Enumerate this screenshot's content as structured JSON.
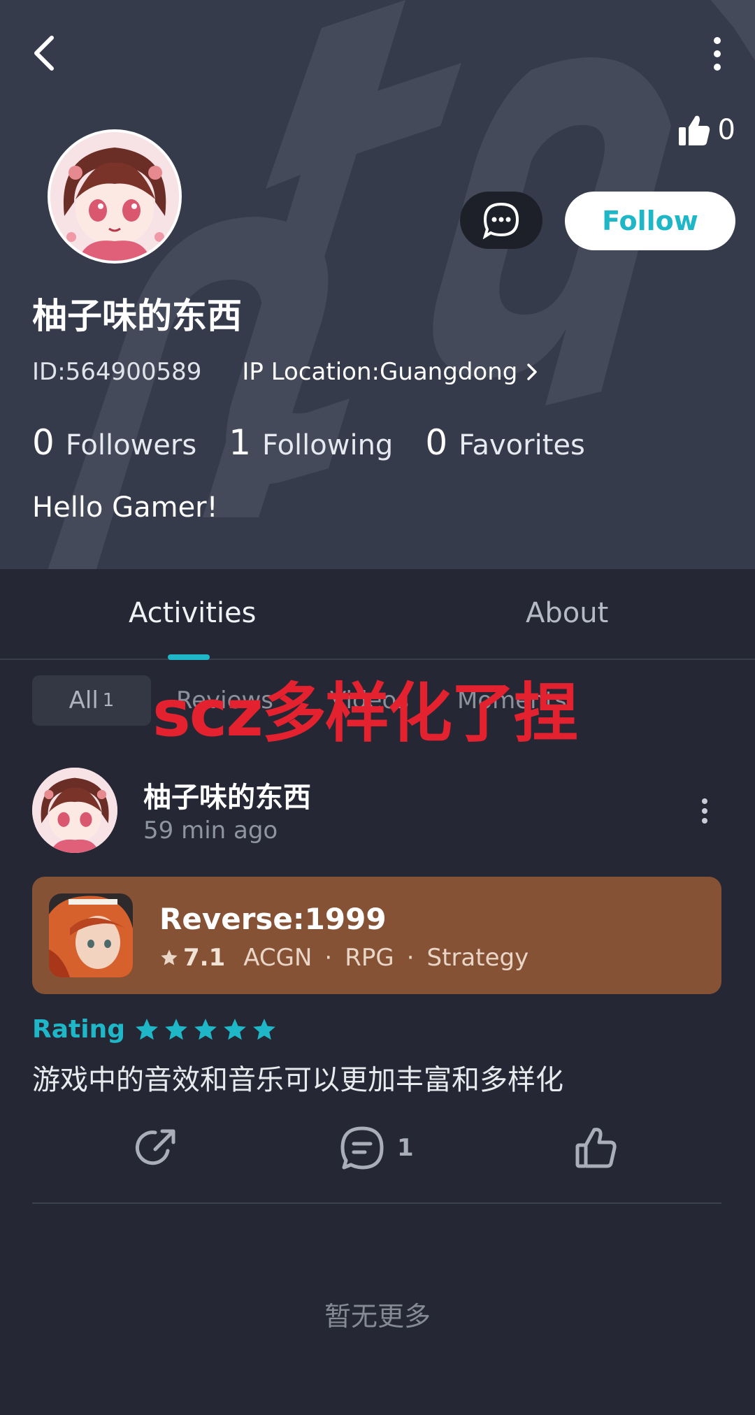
{
  "header": {
    "like_count": "0",
    "follow_label": "Follow",
    "username": "柚子味的东西",
    "user_id": "ID:564900589",
    "ip_location": "IP Location:Guangdong",
    "stats": [
      {
        "count": "0",
        "label": "Followers"
      },
      {
        "count": "1",
        "label": "Following"
      },
      {
        "count": "0",
        "label": "Favorites"
      }
    ],
    "bio": "Hello Gamer!"
  },
  "tabs": [
    {
      "label": "Activities",
      "active": true
    },
    {
      "label": "About",
      "active": false
    }
  ],
  "filters": {
    "all_label": "All",
    "all_count": "1",
    "chips": [
      "Reviews",
      "Videos",
      "Moments"
    ]
  },
  "overlay_text": "scz多样化了捏",
  "post": {
    "author": "柚子味的东西",
    "time": "59 min ago",
    "game": {
      "title": "Reverse:1999",
      "score": "7.1",
      "tags": [
        "ACGN",
        "RPG",
        "Strategy"
      ]
    },
    "rating_label": "Rating",
    "rating_stars": 5,
    "review": "游戏中的音效和音乐可以更加丰富和多样化",
    "comment_count": "1"
  },
  "footer": {
    "no_more": "暂无更多"
  },
  "colors": {
    "accent": "#1fb7c7",
    "header_bg": "#363b4b",
    "page_bg": "#252834",
    "game_card": "#865236",
    "overlay": "#e3212f"
  },
  "icons": [
    "back-arrow-icon",
    "more-vertical-icon",
    "thumbs-up-icon",
    "chat-bubble-icon",
    "chevron-right-icon",
    "star-icon",
    "share-icon",
    "comment-icon",
    "like-icon"
  ]
}
